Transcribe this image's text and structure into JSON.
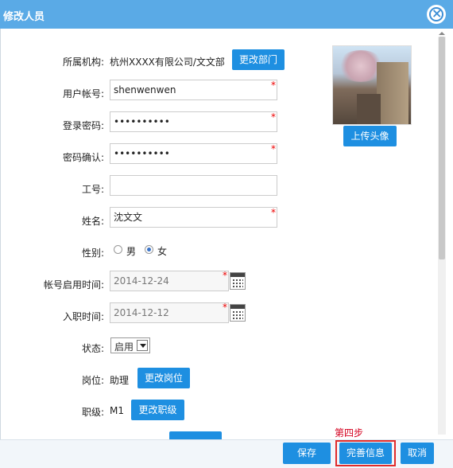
{
  "dialog": {
    "title": "修改人员"
  },
  "form": {
    "org_label": "所属机构:",
    "org_value": "杭州XXXX有限公司/文文部",
    "change_dept_label": "更改部门",
    "account_label": "用户帐号:",
    "account_value": "shenwenwen",
    "password_label": "登录密码:",
    "password_value": "••••••••••",
    "password_confirm_label": "密码确认:",
    "password_confirm_value": "••••••••••",
    "employee_no_label": "工号:",
    "employee_no_value": "",
    "name_label": "姓名:",
    "name_value": "沈文文",
    "gender_label": "性别:",
    "gender_male": "男",
    "gender_female": "女",
    "gender_selected": "女",
    "enable_date_label": "帐号启用时间:",
    "enable_date_value": "2014-12-24",
    "hire_date_label": "入职时间:",
    "hire_date_value": "2014-12-12",
    "status_label": "状态:",
    "status_value": "启用",
    "position_label": "岗位:",
    "position_value": "助理",
    "change_position_label": "更改岗位",
    "rank_label": "职级:",
    "rank_value": "M1",
    "change_rank_label": "更改职级",
    "required_mark": "*"
  },
  "avatar": {
    "upload_label": "上传头像"
  },
  "footer": {
    "step_note": "第四步",
    "save_label": "保存",
    "complete_info_label": "完善信息",
    "cancel_label": "取消"
  },
  "colors": {
    "titlebar": "#5aaae6",
    "button": "#1e8fe1",
    "highlight": "#e02b2b"
  },
  "icons": {
    "close": "close-icon",
    "calendar": "calendar-icon",
    "dropdown": "chevron-down-icon"
  }
}
